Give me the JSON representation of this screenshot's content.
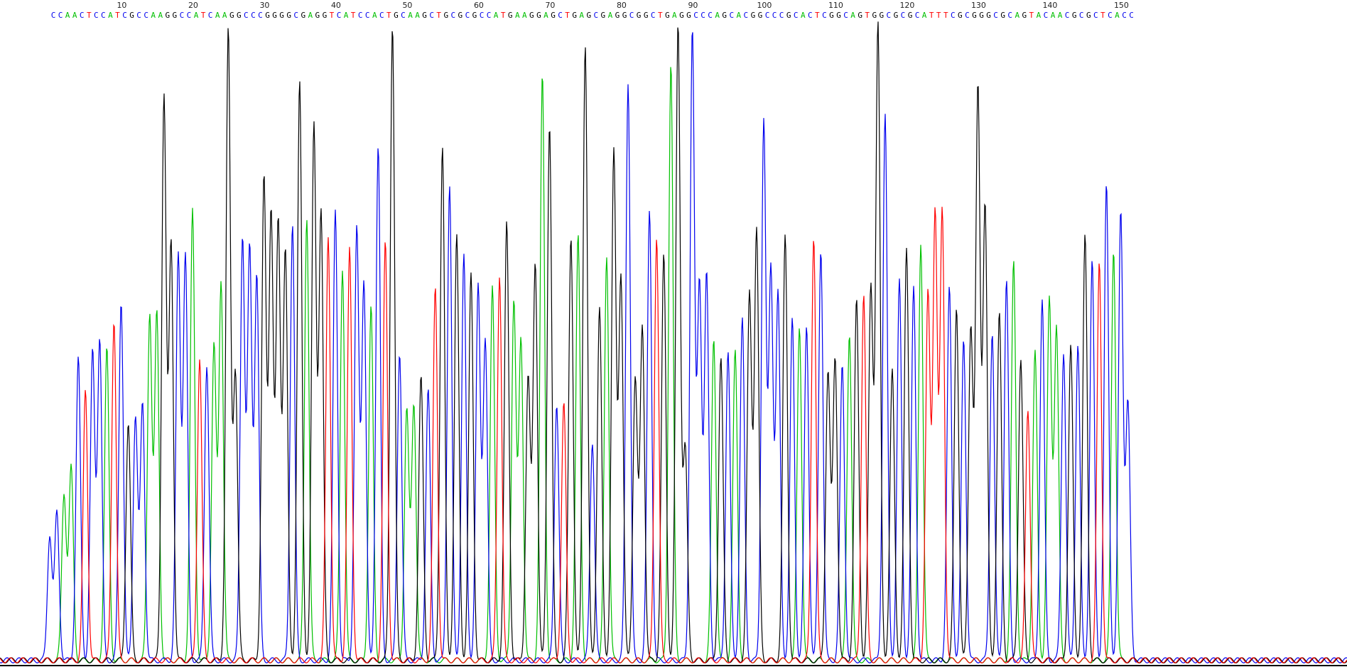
{
  "chart_data": {
    "type": "line",
    "bases": "CCAACTCCATCGCCAAGGCCATCAAGGCCCGGGGCGAGGTCATCCACTGCAAGCTGCGCGCCATGAAGGAGCTGAGCGAGGCGGCTGAGGCCCAGCACGGCCCGCACTCGGCAGTGGCGCGCATTTCGCGGGCGCAGTACAACGCGCTCACC",
    "position_ticks": [
      10,
      20,
      30,
      40,
      50,
      60,
      70,
      80,
      90,
      100,
      110,
      120,
      130,
      140,
      150
    ],
    "base_colors": {
      "A": "#00c000",
      "C": "#0000ee",
      "G": "#000000",
      "T": "#ff0000"
    },
    "y_max": 1000,
    "peak_heights": [
      195,
      230,
      260,
      300,
      470,
      420,
      480,
      500,
      485,
      530,
      560,
      370,
      380,
      400,
      540,
      540,
      880,
      650,
      630,
      630,
      700,
      470,
      460,
      490,
      590,
      980,
      450,
      660,
      640,
      600,
      750,
      700,
      680,
      640,
      680,
      900,
      690,
      830,
      700,
      660,
      700,
      610,
      640,
      670,
      590,
      550,
      800,
      650,
      990,
      480,
      390,
      400,
      440,
      420,
      580,
      800,
      740,
      660,
      630,
      600,
      580,
      500,
      580,
      600,
      680,
      560,
      500,
      440,
      620,
      910,
      835,
      400,
      400,
      660,
      660,
      960,
      340,
      550,
      630,
      790,
      600,
      900,
      440,
      520,
      700,
      660,
      630,
      930,
      990,
      330,
      980,
      590,
      600,
      500,
      470,
      480,
      480,
      530,
      570,
      670,
      840,
      610,
      570,
      660,
      530,
      520,
      520,
      660,
      640,
      450,
      470,
      460,
      510,
      560,
      570,
      580,
      990,
      850,
      450,
      590,
      640,
      580,
      650,
      570,
      700,
      700,
      580,
      550,
      500,
      520,
      890,
      710,
      510,
      540,
      590,
      620,
      470,
      390,
      480,
      560,
      560,
      520,
      480,
      490,
      490,
      660,
      620,
      620,
      740,
      640,
      700
    ]
  }
}
